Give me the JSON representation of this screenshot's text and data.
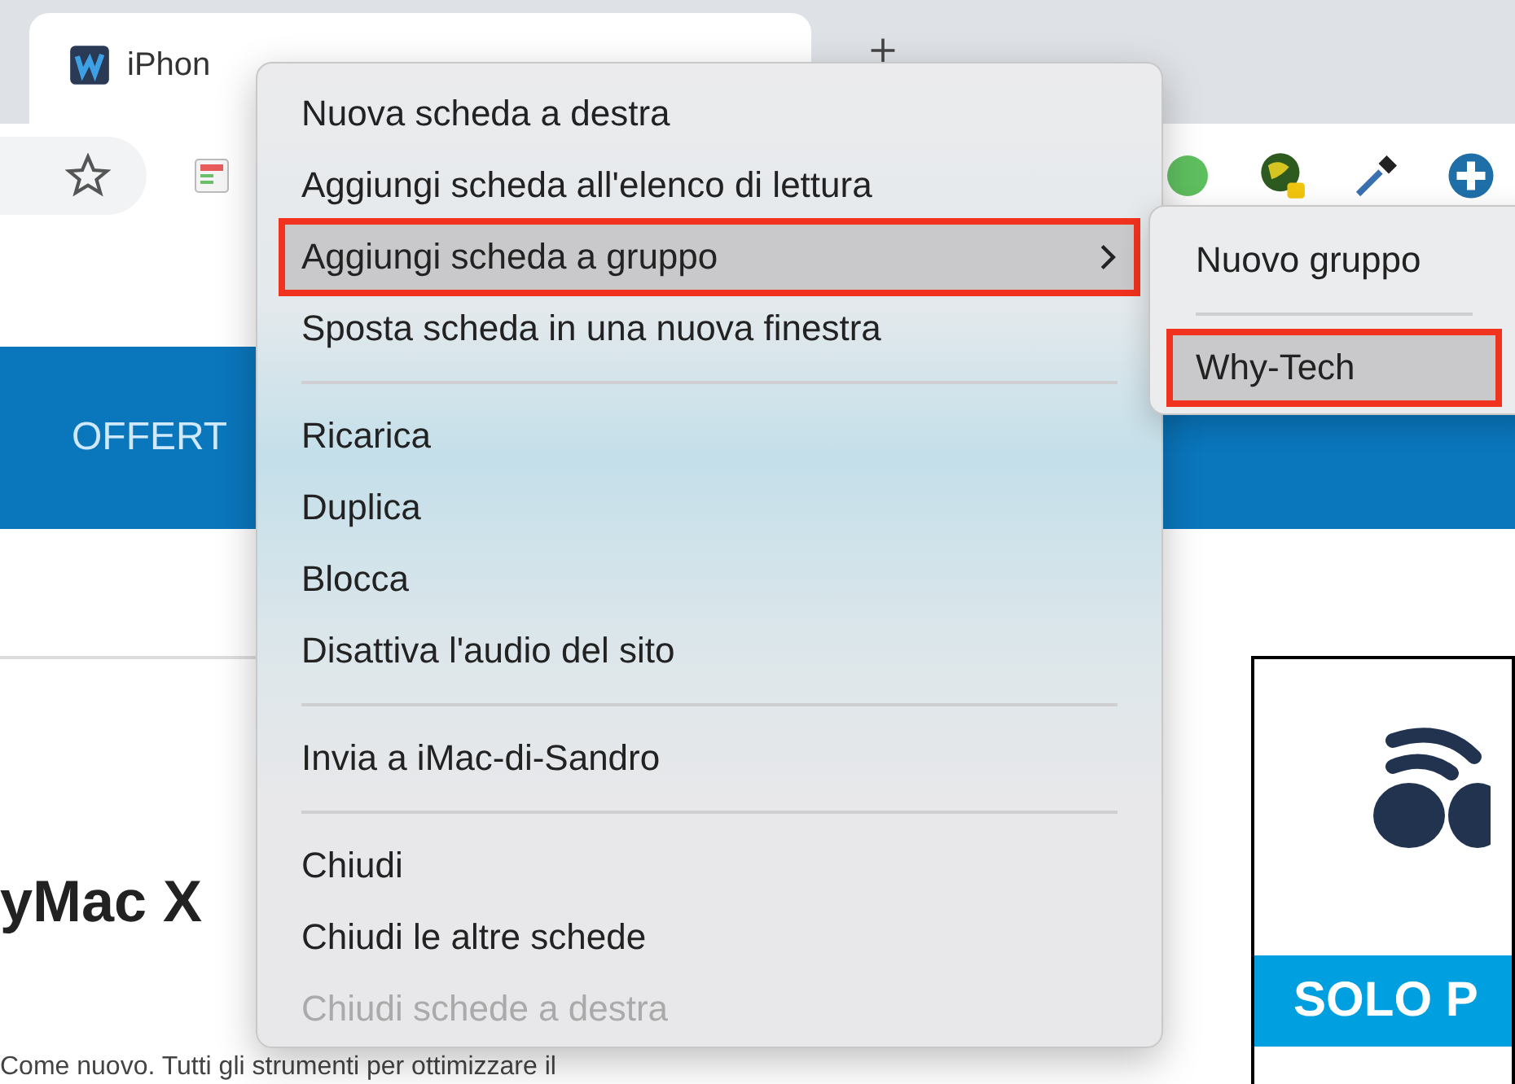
{
  "tab": {
    "title": "iPhon"
  },
  "page": {
    "nav_label": "OFFERT",
    "heading": "yMac X",
    "body_text": "Come nuovo. Tutti gli strumenti per ottimizzare il",
    "ad_label": "SOLO P"
  },
  "context_menu": {
    "items": [
      {
        "kind": "item",
        "label": "Nuova scheda a destra",
        "disabled": false,
        "selected": false,
        "submenu": false
      },
      {
        "kind": "item",
        "label": "Aggiungi scheda all'elenco di lettura",
        "disabled": false,
        "selected": false,
        "submenu": false
      },
      {
        "kind": "item",
        "label": "Aggiungi scheda a gruppo",
        "disabled": false,
        "selected": true,
        "submenu": true
      },
      {
        "kind": "item",
        "label": "Sposta scheda in una nuova finestra",
        "disabled": false,
        "selected": false,
        "submenu": false
      },
      {
        "kind": "separator"
      },
      {
        "kind": "item",
        "label": "Ricarica",
        "disabled": false,
        "selected": false,
        "submenu": false
      },
      {
        "kind": "item",
        "label": "Duplica",
        "disabled": false,
        "selected": false,
        "submenu": false
      },
      {
        "kind": "item",
        "label": "Blocca",
        "disabled": false,
        "selected": false,
        "submenu": false
      },
      {
        "kind": "item",
        "label": "Disattiva l'audio del sito",
        "disabled": false,
        "selected": false,
        "submenu": false
      },
      {
        "kind": "separator"
      },
      {
        "kind": "item",
        "label": "Invia a iMac-di-Sandro",
        "disabled": false,
        "selected": false,
        "submenu": false
      },
      {
        "kind": "separator"
      },
      {
        "kind": "item",
        "label": "Chiudi",
        "disabled": false,
        "selected": false,
        "submenu": false
      },
      {
        "kind": "item",
        "label": "Chiudi le altre schede",
        "disabled": false,
        "selected": false,
        "submenu": false
      },
      {
        "kind": "item",
        "label": "Chiudi schede a destra",
        "disabled": true,
        "selected": false,
        "submenu": false
      }
    ]
  },
  "submenu": {
    "items": [
      {
        "kind": "item",
        "label": "Nuovo gruppo",
        "selected": false
      },
      {
        "kind": "separator"
      },
      {
        "kind": "item",
        "label": "Why-Tech",
        "selected": true
      }
    ]
  }
}
